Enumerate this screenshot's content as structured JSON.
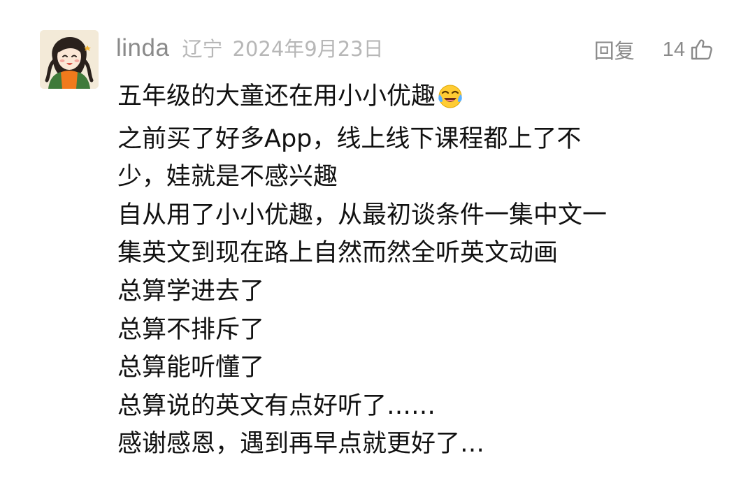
{
  "comment": {
    "username": "linda",
    "location": "辽宁",
    "date": "2024年9月23日",
    "reply_label": "回复",
    "like_count": "14",
    "lines": [
      "五年级的大童还在用小小优趣",
      "之前买了好多App，线上线下课程都上了不",
      "少，娃就是不感兴趣",
      "自从用了小小优趣，从最初谈条件一集中文一",
      "集英文到现在路上自然而然全听英文动画",
      "总算学进去了",
      "总算不排斥了",
      "总算能听懂了",
      "总算说的英文有点好听了……",
      "感谢感恩，遇到再早点就更好了…"
    ],
    "icons": {
      "emoji": "laughing-tears-emoji-icon",
      "like": "thumbs-up-icon"
    }
  },
  "colors": {
    "username": "#8a8a8a",
    "meta": "#b7b7b7",
    "body_text": "#111111"
  }
}
